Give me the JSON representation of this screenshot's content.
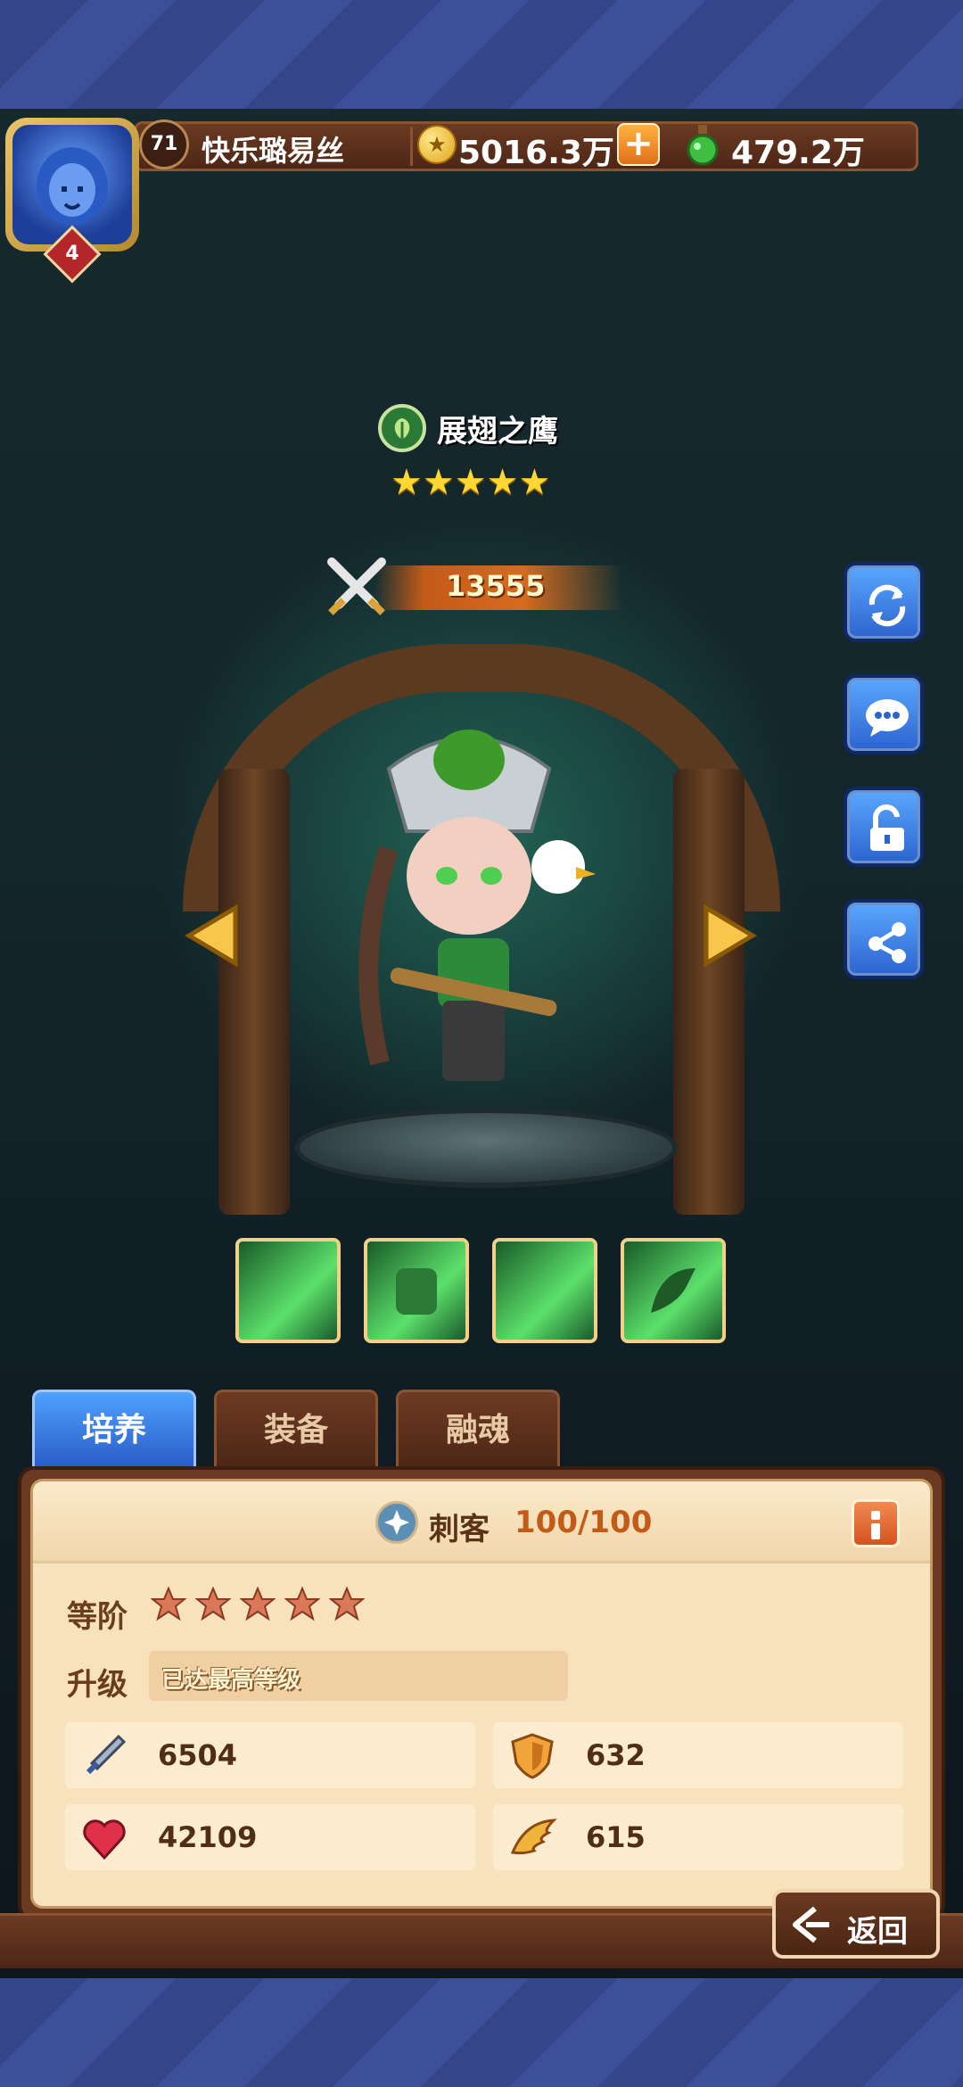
{
  "player": {
    "level": "71",
    "name": "快乐璐易丝",
    "avatar_rank": "4",
    "gold": "5016.3万",
    "potion": "479.2万"
  },
  "hero": {
    "name": "展翅之鹰",
    "stars": "★★★★★",
    "power": "13555",
    "element_icon": "leaf-icon"
  },
  "tabs": [
    "培养",
    "装备",
    "融魂"
  ],
  "panel": {
    "class_name": "刺客",
    "class_count": "100/100",
    "grade_label": "等阶",
    "grade_stars": 5,
    "upgrade_label": "升级",
    "upgrade_status": "已达最高等级",
    "stats": {
      "attack": "6504",
      "defense": "632",
      "hp": "42109",
      "speed": "615"
    }
  },
  "back_label": "返回",
  "colors": {
    "accent_blue": "#2c63cf",
    "wood_brown": "#6b3a22",
    "panel_bg": "#f8e2bd",
    "power_orange": "#d66b1f"
  }
}
